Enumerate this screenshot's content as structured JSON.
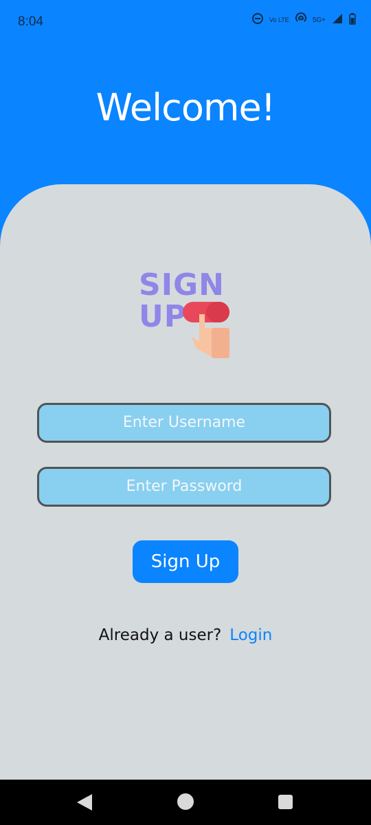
{
  "status_bar": {
    "time": "8:04",
    "icons": [
      "do-not-disturb-icon",
      "volte-icon",
      "hotspot-icon",
      "5g-icon",
      "signal-icon",
      "battery-icon"
    ],
    "network_label": "5G+",
    "volte_label": "Vo LTE"
  },
  "header": {
    "title": "Welcome!",
    "background": "#0a84ff"
  },
  "logo": {
    "line1": "SIGN",
    "line2": "UP"
  },
  "form": {
    "username_placeholder": "Enter Username",
    "password_placeholder": "Enter Password",
    "signup_label": "Sign Up"
  },
  "footer": {
    "already_text": "Already a user?",
    "login_label": "Login"
  },
  "colors": {
    "accent": "#0a84ff",
    "card_bg": "#d5dadc",
    "input_bg": "#89cff0"
  }
}
